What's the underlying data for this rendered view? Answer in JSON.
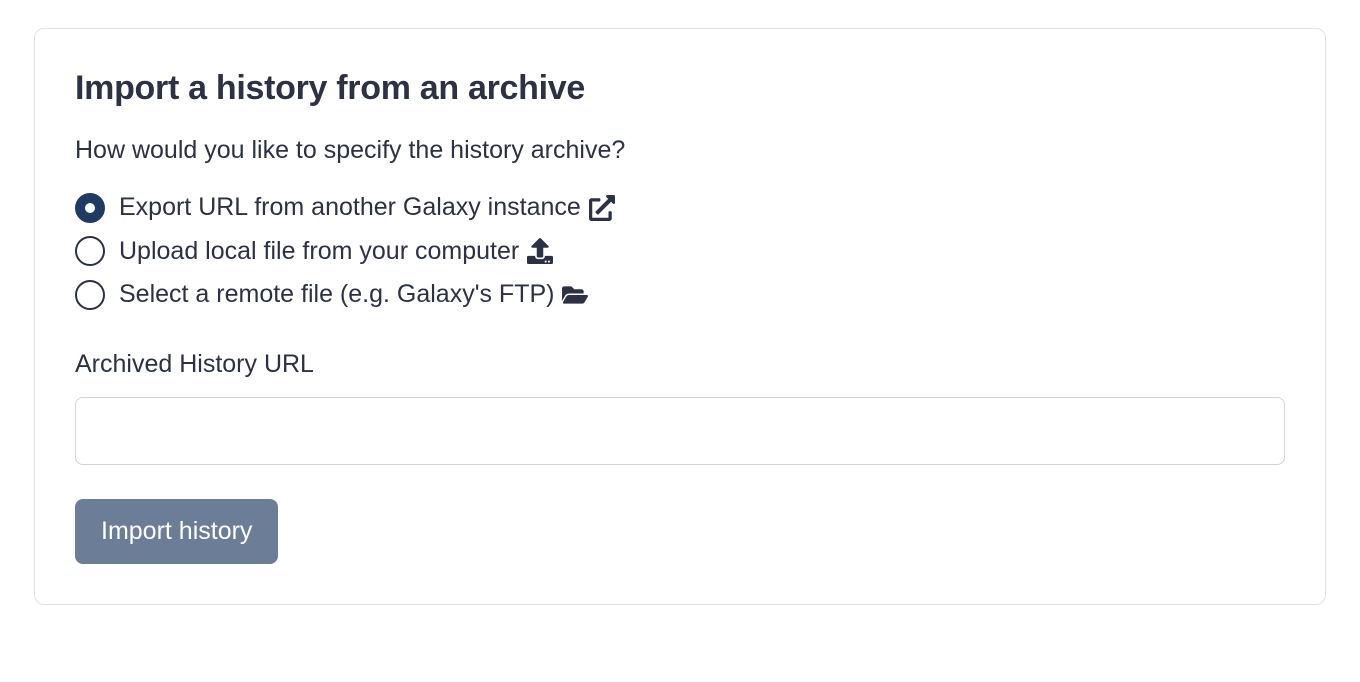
{
  "panel": {
    "title": "Import a history from an archive",
    "subtitle": "How would you like to specify the history archive?"
  },
  "radios": {
    "export_url": {
      "label": "Export URL from another Galaxy instance",
      "selected": true
    },
    "upload_local": {
      "label": "Upload local file from your computer",
      "selected": false
    },
    "remote_file": {
      "label": "Select a remote file (e.g. Galaxy's FTP)",
      "selected": false
    }
  },
  "field": {
    "label": "Archived History URL",
    "value": ""
  },
  "button": {
    "import_label": "Import history"
  }
}
